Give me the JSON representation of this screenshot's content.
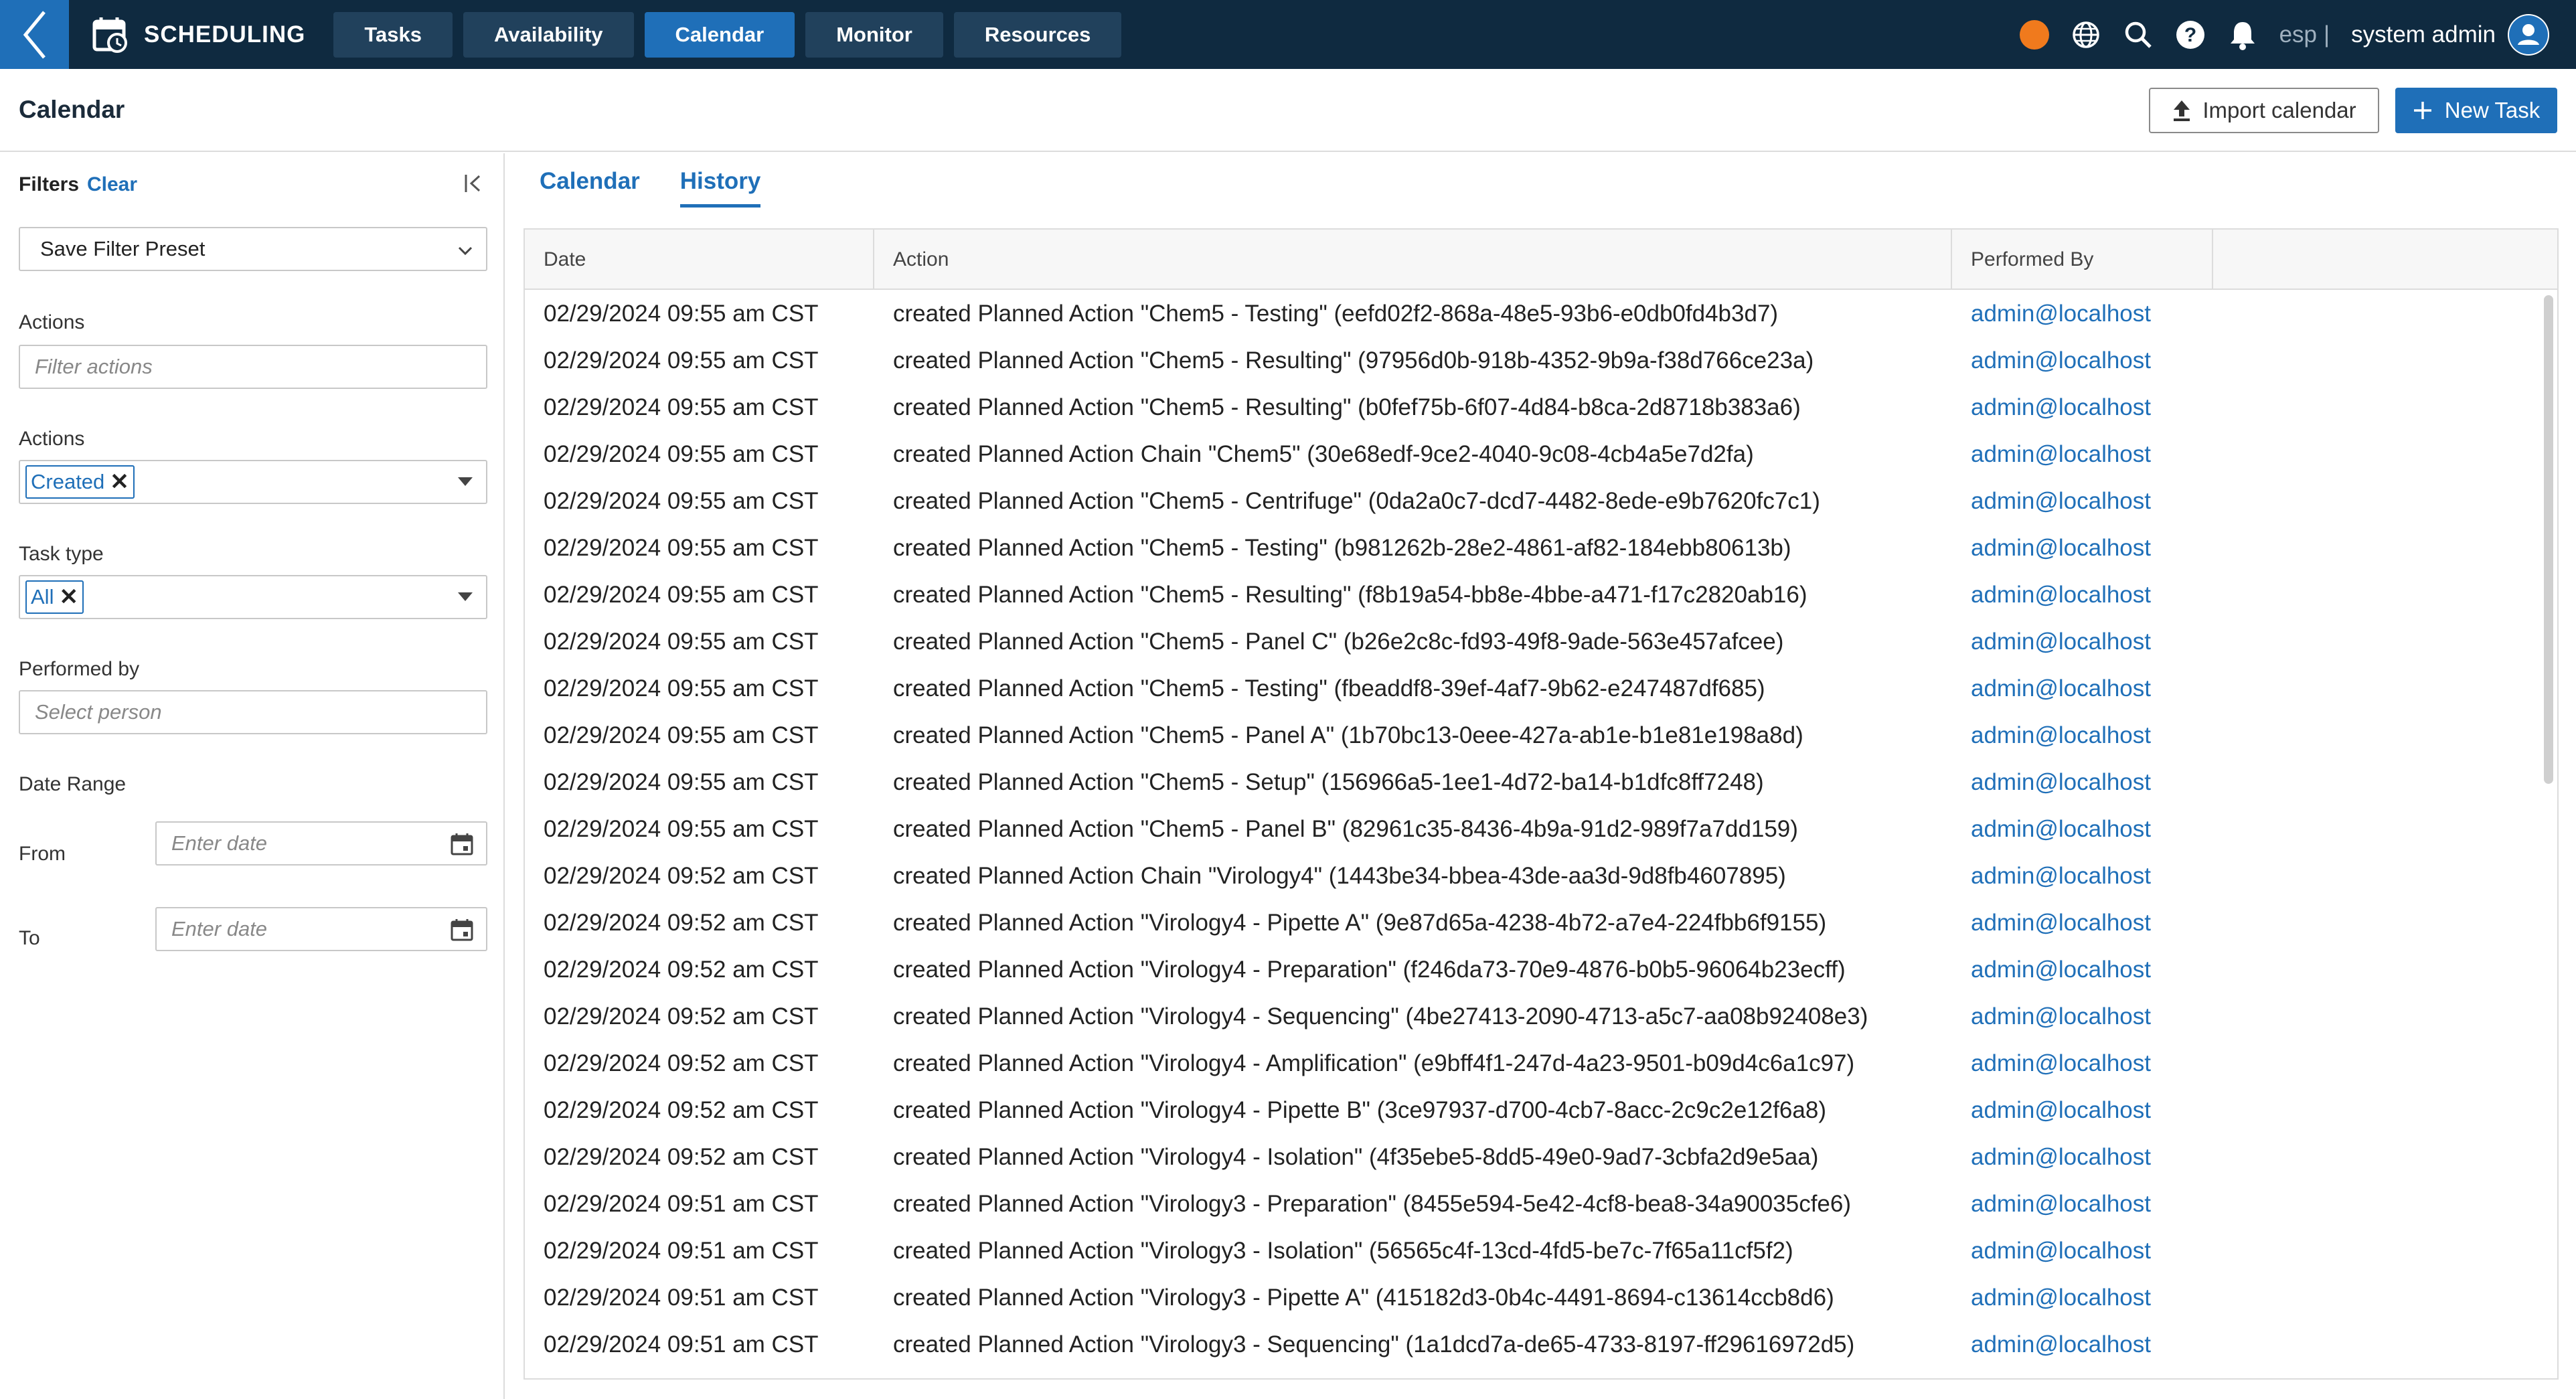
{
  "topbar": {
    "app_title": "SCHEDULING",
    "nav": [
      "Tasks",
      "Availability",
      "Calendar",
      "Monitor",
      "Resources"
    ],
    "active_nav": "Calendar",
    "lang": "esp",
    "separator": "|",
    "user": "system admin",
    "status_color": "#f07a1d",
    "icons": [
      "back-icon",
      "calendar-app-icon",
      "globe-icon",
      "search-icon",
      "help-icon",
      "bell-icon",
      "user-icon"
    ]
  },
  "page": {
    "title": "Calendar",
    "import_label": "Import calendar",
    "new_task_label": "New Task"
  },
  "filters": {
    "title": "Filters",
    "clear": "Clear",
    "preset": "Save Filter Preset",
    "actions_label": "Actions",
    "actions_placeholder": "Filter actions",
    "actions2_label": "Actions",
    "actions_chip": "Created",
    "task_type_label": "Task type",
    "task_type_chip": "All",
    "performed_label": "Performed by",
    "performed_placeholder": "Select person",
    "date_range_label": "Date Range",
    "from_label": "From",
    "to_label": "To",
    "date_placeholder": "Enter date"
  },
  "tabs": [
    "Calendar",
    "History"
  ],
  "active_tab": "History",
  "table": {
    "columns": [
      "Date",
      "Action",
      "Performed By"
    ],
    "rows": [
      {
        "date": "02/29/2024 09:55 am CST",
        "action": "created Planned Action \"Chem5 - Testing\" (eefd02f2-868a-48e5-93b6-e0db0fd4b3d7)",
        "by": "admin@localhost"
      },
      {
        "date": "02/29/2024 09:55 am CST",
        "action": "created Planned Action \"Chem5 - Resulting\" (97956d0b-918b-4352-9b9a-f38d766ce23a)",
        "by": "admin@localhost"
      },
      {
        "date": "02/29/2024 09:55 am CST",
        "action": "created Planned Action \"Chem5 - Resulting\" (b0fef75b-6f07-4d84-b8ca-2d8718b383a6)",
        "by": "admin@localhost"
      },
      {
        "date": "02/29/2024 09:55 am CST",
        "action": "created Planned Action Chain \"Chem5\" (30e68edf-9ce2-4040-9c08-4cb4a5e7d2fa)",
        "by": "admin@localhost"
      },
      {
        "date": "02/29/2024 09:55 am CST",
        "action": "created Planned Action \"Chem5 - Centrifuge\" (0da2a0c7-dcd7-4482-8ede-e9b7620fc7c1)",
        "by": "admin@localhost"
      },
      {
        "date": "02/29/2024 09:55 am CST",
        "action": "created Planned Action \"Chem5 - Testing\" (b981262b-28e2-4861-af82-184ebb80613b)",
        "by": "admin@localhost"
      },
      {
        "date": "02/29/2024 09:55 am CST",
        "action": "created Planned Action \"Chem5 - Resulting\" (f8b19a54-bb8e-4bbe-a471-f17c2820ab16)",
        "by": "admin@localhost"
      },
      {
        "date": "02/29/2024 09:55 am CST",
        "action": "created Planned Action \"Chem5 - Panel C\" (b26e2c8c-fd93-49f8-9ade-563e457afcee)",
        "by": "admin@localhost"
      },
      {
        "date": "02/29/2024 09:55 am CST",
        "action": "created Planned Action \"Chem5 - Testing\" (fbeaddf8-39ef-4af7-9b62-e247487df685)",
        "by": "admin@localhost"
      },
      {
        "date": "02/29/2024 09:55 am CST",
        "action": "created Planned Action \"Chem5 - Panel A\" (1b70bc13-0eee-427a-ab1e-b1e81e198a8d)",
        "by": "admin@localhost"
      },
      {
        "date": "02/29/2024 09:55 am CST",
        "action": "created Planned Action \"Chem5 - Setup\" (156966a5-1ee1-4d72-ba14-b1dfc8ff7248)",
        "by": "admin@localhost"
      },
      {
        "date": "02/29/2024 09:55 am CST",
        "action": "created Planned Action \"Chem5 - Panel B\" (82961c35-8436-4b9a-91d2-989f7a7dd159)",
        "by": "admin@localhost"
      },
      {
        "date": "02/29/2024 09:52 am CST",
        "action": "created Planned Action Chain \"Virology4\" (1443be34-bbea-43de-aa3d-9d8fb4607895)",
        "by": "admin@localhost"
      },
      {
        "date": "02/29/2024 09:52 am CST",
        "action": "created Planned Action \"Virology4 - Pipette A\" (9e87d65a-4238-4b72-a7e4-224fbb6f9155)",
        "by": "admin@localhost"
      },
      {
        "date": "02/29/2024 09:52 am CST",
        "action": "created Planned Action \"Virology4 - Preparation\" (f246da73-70e9-4876-b0b5-96064b23ecff)",
        "by": "admin@localhost"
      },
      {
        "date": "02/29/2024 09:52 am CST",
        "action": "created Planned Action \"Virology4 - Sequencing\" (4be27413-2090-4713-a5c7-aa08b92408e3)",
        "by": "admin@localhost"
      },
      {
        "date": "02/29/2024 09:52 am CST",
        "action": "created Planned Action \"Virology4 - Amplification\" (e9bff4f1-247d-4a23-9501-b09d4c6a1c97)",
        "by": "admin@localhost"
      },
      {
        "date": "02/29/2024 09:52 am CST",
        "action": "created Planned Action \"Virology4 - Pipette B\" (3ce97937-d700-4cb7-8acc-2c9c2e12f6a8)",
        "by": "admin@localhost"
      },
      {
        "date": "02/29/2024 09:52 am CST",
        "action": "created Planned Action \"Virology4 - Isolation\" (4f35ebe5-8dd5-49e0-9ad7-3cbfa2d9e5aa)",
        "by": "admin@localhost"
      },
      {
        "date": "02/29/2024 09:51 am CST",
        "action": "created Planned Action \"Virology3 - Preparation\" (8455e594-5e42-4cf8-bea8-34a90035cfe6)",
        "by": "admin@localhost"
      },
      {
        "date": "02/29/2024 09:51 am CST",
        "action": "created Planned Action \"Virology3 - Isolation\" (56565c4f-13cd-4fd5-be7c-7f65a11cf5f2)",
        "by": "admin@localhost"
      },
      {
        "date": "02/29/2024 09:51 am CST",
        "action": "created Planned Action \"Virology3 - Pipette A\" (415182d3-0b4c-4491-8694-c13614ccb8d6)",
        "by": "admin@localhost"
      },
      {
        "date": "02/29/2024 09:51 am CST",
        "action": "created Planned Action \"Virology3 - Sequencing\" (1a1dcd7a-de65-4733-8197-ff29616972d5)",
        "by": "admin@localhost"
      }
    ]
  },
  "colors": {
    "brand_dark": "#0f2a40",
    "accent": "#1f6fb8",
    "status": "#f07a1d"
  }
}
